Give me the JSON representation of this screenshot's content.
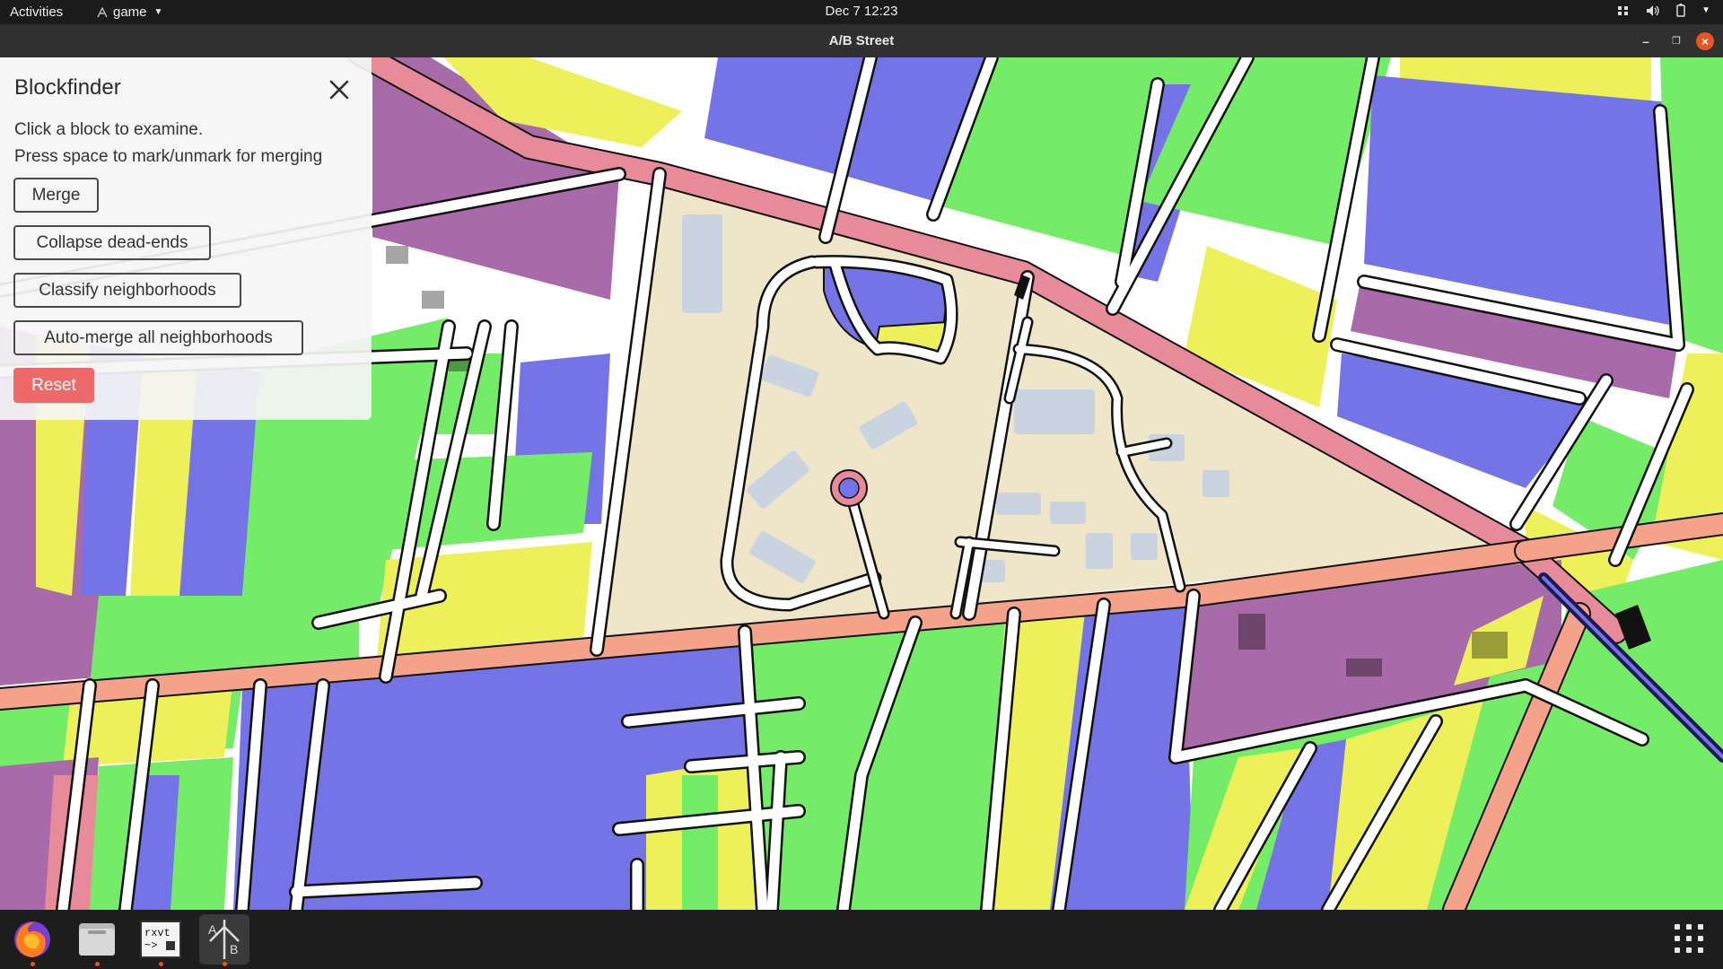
{
  "topbar": {
    "activities": "Activities",
    "app_menu": "game",
    "clock": "Dec 7  12:23"
  },
  "window": {
    "title": "A/B Street"
  },
  "panel": {
    "title": "Blockfinder",
    "help_line1": "Click a block to examine.",
    "help_line2": "Press space to mark/unmark for merging",
    "buttons": {
      "merge": "Merge",
      "collapse": "Collapse dead-ends",
      "classify": "Classify neighborhoods",
      "automerge": "Auto-merge all neighborhoods",
      "reset": "Reset"
    }
  },
  "colors": {
    "green": "#75ec68",
    "blue": "#7474e6",
    "yellow": "#eef05a",
    "purple": "#a86aa8",
    "pink": "#e78a9a",
    "beige": "#efe6ca",
    "arterial": "#f4a28a",
    "selected_block": "#efe6ca"
  },
  "dock": {
    "apps": [
      {
        "name": "firefox",
        "running": true
      },
      {
        "name": "files",
        "running": true
      },
      {
        "name": "rxvt",
        "running": true
      },
      {
        "name": "abstreet",
        "running": true,
        "active": true
      }
    ],
    "rxvt_label": "rxvt\n~>"
  }
}
